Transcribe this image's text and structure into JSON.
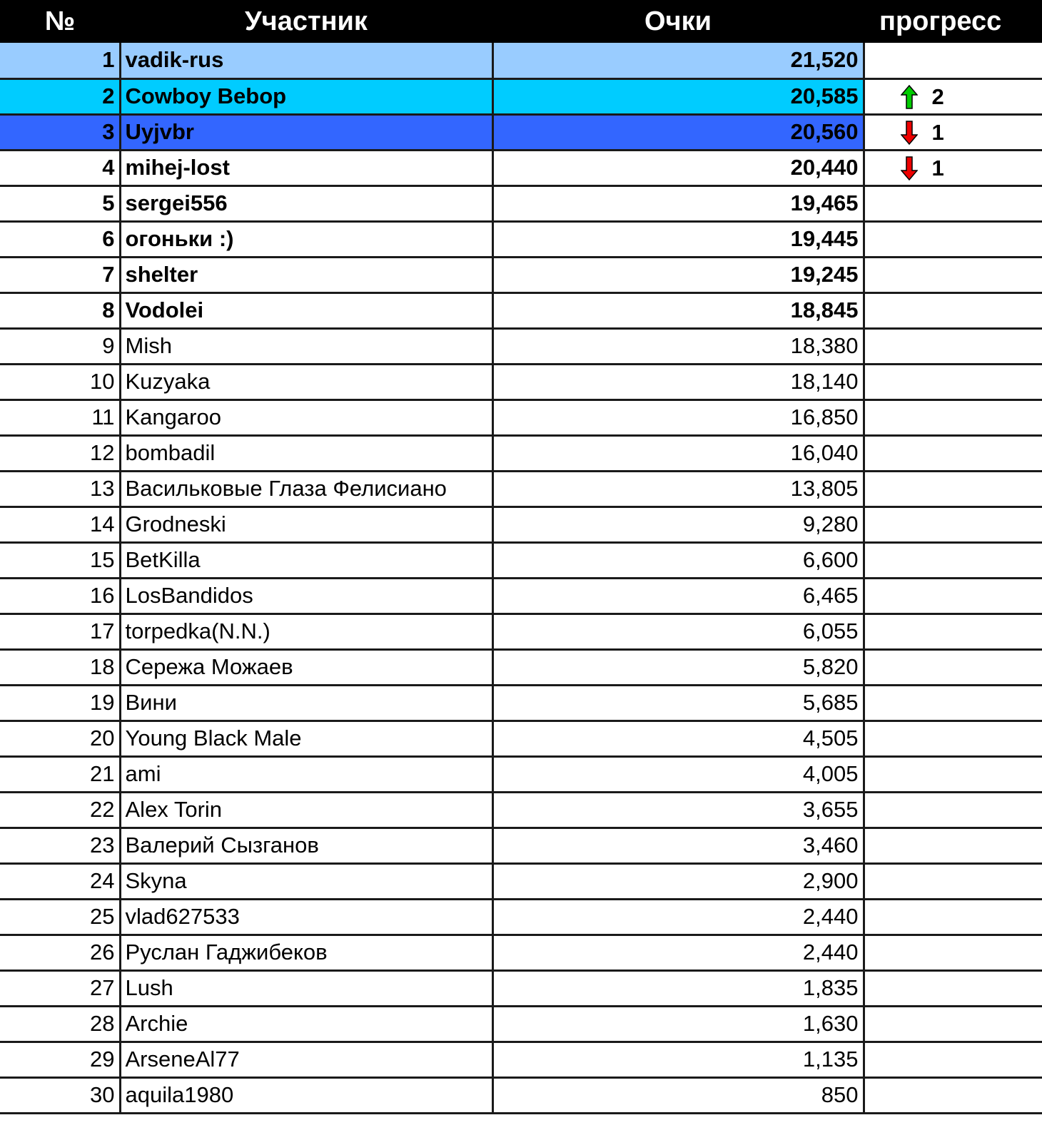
{
  "header": {
    "num": "№",
    "name": "Участник",
    "points": "Очки",
    "progress": "прогресс"
  },
  "colors": {
    "header_bg": "#000000",
    "row1_bg": "#99ccff",
    "row2_bg": "#00ccff",
    "row3_bg": "#3366ff",
    "arrow_up": "#00cc00",
    "arrow_down": "#ee0000"
  },
  "rows": [
    {
      "num": "1",
      "name": "vadik-rus",
      "points": "21,520",
      "bold": true,
      "bg": "#99ccff",
      "progress": null
    },
    {
      "num": "2",
      "name": "Cowboy Bebop",
      "points": "20,585",
      "bold": true,
      "bg": "#00ccff",
      "progress": {
        "direction": "up",
        "icon": "green-up-arrow-icon",
        "value": "2"
      }
    },
    {
      "num": "3",
      "name": "Uyjvbr",
      "points": "20,560",
      "bold": true,
      "bg": "#3366ff",
      "progress": {
        "direction": "down",
        "icon": "red-down-arrow-icon",
        "value": "1"
      }
    },
    {
      "num": "4",
      "name": "mihej-lost",
      "points": "20,440",
      "bold": true,
      "bg": null,
      "progress": {
        "direction": "down",
        "icon": "red-down-arrow-icon",
        "value": "1"
      }
    },
    {
      "num": "5",
      "name": "sergei556",
      "points": "19,465",
      "bold": true,
      "bg": null,
      "progress": null
    },
    {
      "num": "6",
      "name": "огоньки :)",
      "points": "19,445",
      "bold": true,
      "bg": null,
      "progress": null
    },
    {
      "num": "7",
      "name": "shelter",
      "points": "19,245",
      "bold": true,
      "bg": null,
      "progress": null
    },
    {
      "num": "8",
      "name": "Vodolei",
      "points": "18,845",
      "bold": true,
      "bg": null,
      "progress": null
    },
    {
      "num": "9",
      "name": "Mish",
      "points": "18,380",
      "bold": false,
      "bg": null,
      "progress": null
    },
    {
      "num": "10",
      "name": "Kuzyaka",
      "points": "18,140",
      "bold": false,
      "bg": null,
      "progress": null
    },
    {
      "num": "11",
      "name": "Kangaroo",
      "points": "16,850",
      "bold": false,
      "bg": null,
      "progress": null
    },
    {
      "num": "12",
      "name": "bombadil",
      "points": "16,040",
      "bold": false,
      "bg": null,
      "progress": null
    },
    {
      "num": "13",
      "name": "Васильковые Глаза Фелисиано",
      "points": "13,805",
      "bold": false,
      "bg": null,
      "progress": null
    },
    {
      "num": "14",
      "name": "Grodneski",
      "points": "9,280",
      "bold": false,
      "bg": null,
      "progress": null
    },
    {
      "num": "15",
      "name": "BetKilla",
      "points": "6,600",
      "bold": false,
      "bg": null,
      "progress": null
    },
    {
      "num": "16",
      "name": "LosBandidos",
      "points": "6,465",
      "bold": false,
      "bg": null,
      "progress": null
    },
    {
      "num": "17",
      "name": "torpedka(N.N.)",
      "points": "6,055",
      "bold": false,
      "bg": null,
      "progress": null
    },
    {
      "num": "18",
      "name": "Сережа Можаев",
      "points": "5,820",
      "bold": false,
      "bg": null,
      "progress": null
    },
    {
      "num": "19",
      "name": "Вини",
      "points": "5,685",
      "bold": false,
      "bg": null,
      "progress": null
    },
    {
      "num": "20",
      "name": "Young Black Male",
      "points": "4,505",
      "bold": false,
      "bg": null,
      "progress": null
    },
    {
      "num": "21",
      "name": "ami",
      "points": "4,005",
      "bold": false,
      "bg": null,
      "progress": null
    },
    {
      "num": "22",
      "name": "Alex Torin",
      "points": "3,655",
      "bold": false,
      "bg": null,
      "progress": null
    },
    {
      "num": "23",
      "name": "Валерий Сызганов",
      "points": "3,460",
      "bold": false,
      "bg": null,
      "progress": null
    },
    {
      "num": "24",
      "name": "Skyna",
      "points": "2,900",
      "bold": false,
      "bg": null,
      "progress": null
    },
    {
      "num": "25",
      "name": "vlad627533",
      "points": "2,440",
      "bold": false,
      "bg": null,
      "progress": null
    },
    {
      "num": "26",
      "name": "Руслан Гаджибеков",
      "points": "2,440",
      "bold": false,
      "bg": null,
      "progress": null
    },
    {
      "num": "27",
      "name": "Lush",
      "points": "1,835",
      "bold": false,
      "bg": null,
      "progress": null
    },
    {
      "num": "28",
      "name": "Archie",
      "points": "1,630",
      "bold": false,
      "bg": null,
      "progress": null
    },
    {
      "num": "29",
      "name": "ArseneAl77",
      "points": "1,135",
      "bold": false,
      "bg": null,
      "progress": null
    },
    {
      "num": "30",
      "name": "aquila1980",
      "points": "850",
      "bold": false,
      "bg": null,
      "progress": null
    }
  ]
}
